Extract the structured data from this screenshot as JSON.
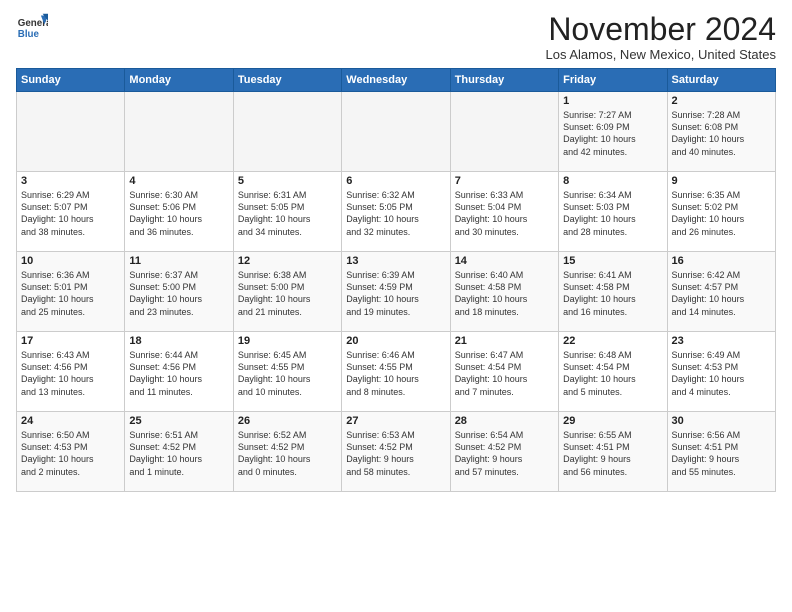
{
  "header": {
    "logo_general": "General",
    "logo_blue": "Blue",
    "month_title": "November 2024",
    "location": "Los Alamos, New Mexico, United States"
  },
  "weekdays": [
    "Sunday",
    "Monday",
    "Tuesday",
    "Wednesday",
    "Thursday",
    "Friday",
    "Saturday"
  ],
  "weeks": [
    [
      {
        "day": "",
        "content": ""
      },
      {
        "day": "",
        "content": ""
      },
      {
        "day": "",
        "content": ""
      },
      {
        "day": "",
        "content": ""
      },
      {
        "day": "",
        "content": ""
      },
      {
        "day": "1",
        "content": "Sunrise: 7:27 AM\nSunset: 6:09 PM\nDaylight: 10 hours\nand 42 minutes."
      },
      {
        "day": "2",
        "content": "Sunrise: 7:28 AM\nSunset: 6:08 PM\nDaylight: 10 hours\nand 40 minutes."
      }
    ],
    [
      {
        "day": "3",
        "content": "Sunrise: 6:29 AM\nSunset: 5:07 PM\nDaylight: 10 hours\nand 38 minutes."
      },
      {
        "day": "4",
        "content": "Sunrise: 6:30 AM\nSunset: 5:06 PM\nDaylight: 10 hours\nand 36 minutes."
      },
      {
        "day": "5",
        "content": "Sunrise: 6:31 AM\nSunset: 5:05 PM\nDaylight: 10 hours\nand 34 minutes."
      },
      {
        "day": "6",
        "content": "Sunrise: 6:32 AM\nSunset: 5:05 PM\nDaylight: 10 hours\nand 32 minutes."
      },
      {
        "day": "7",
        "content": "Sunrise: 6:33 AM\nSunset: 5:04 PM\nDaylight: 10 hours\nand 30 minutes."
      },
      {
        "day": "8",
        "content": "Sunrise: 6:34 AM\nSunset: 5:03 PM\nDaylight: 10 hours\nand 28 minutes."
      },
      {
        "day": "9",
        "content": "Sunrise: 6:35 AM\nSunset: 5:02 PM\nDaylight: 10 hours\nand 26 minutes."
      }
    ],
    [
      {
        "day": "10",
        "content": "Sunrise: 6:36 AM\nSunset: 5:01 PM\nDaylight: 10 hours\nand 25 minutes."
      },
      {
        "day": "11",
        "content": "Sunrise: 6:37 AM\nSunset: 5:00 PM\nDaylight: 10 hours\nand 23 minutes."
      },
      {
        "day": "12",
        "content": "Sunrise: 6:38 AM\nSunset: 5:00 PM\nDaylight: 10 hours\nand 21 minutes."
      },
      {
        "day": "13",
        "content": "Sunrise: 6:39 AM\nSunset: 4:59 PM\nDaylight: 10 hours\nand 19 minutes."
      },
      {
        "day": "14",
        "content": "Sunrise: 6:40 AM\nSunset: 4:58 PM\nDaylight: 10 hours\nand 18 minutes."
      },
      {
        "day": "15",
        "content": "Sunrise: 6:41 AM\nSunset: 4:58 PM\nDaylight: 10 hours\nand 16 minutes."
      },
      {
        "day": "16",
        "content": "Sunrise: 6:42 AM\nSunset: 4:57 PM\nDaylight: 10 hours\nand 14 minutes."
      }
    ],
    [
      {
        "day": "17",
        "content": "Sunrise: 6:43 AM\nSunset: 4:56 PM\nDaylight: 10 hours\nand 13 minutes."
      },
      {
        "day": "18",
        "content": "Sunrise: 6:44 AM\nSunset: 4:56 PM\nDaylight: 10 hours\nand 11 minutes."
      },
      {
        "day": "19",
        "content": "Sunrise: 6:45 AM\nSunset: 4:55 PM\nDaylight: 10 hours\nand 10 minutes."
      },
      {
        "day": "20",
        "content": "Sunrise: 6:46 AM\nSunset: 4:55 PM\nDaylight: 10 hours\nand 8 minutes."
      },
      {
        "day": "21",
        "content": "Sunrise: 6:47 AM\nSunset: 4:54 PM\nDaylight: 10 hours\nand 7 minutes."
      },
      {
        "day": "22",
        "content": "Sunrise: 6:48 AM\nSunset: 4:54 PM\nDaylight: 10 hours\nand 5 minutes."
      },
      {
        "day": "23",
        "content": "Sunrise: 6:49 AM\nSunset: 4:53 PM\nDaylight: 10 hours\nand 4 minutes."
      }
    ],
    [
      {
        "day": "24",
        "content": "Sunrise: 6:50 AM\nSunset: 4:53 PM\nDaylight: 10 hours\nand 2 minutes."
      },
      {
        "day": "25",
        "content": "Sunrise: 6:51 AM\nSunset: 4:52 PM\nDaylight: 10 hours\nand 1 minute."
      },
      {
        "day": "26",
        "content": "Sunrise: 6:52 AM\nSunset: 4:52 PM\nDaylight: 10 hours\nand 0 minutes."
      },
      {
        "day": "27",
        "content": "Sunrise: 6:53 AM\nSunset: 4:52 PM\nDaylight: 9 hours\nand 58 minutes."
      },
      {
        "day": "28",
        "content": "Sunrise: 6:54 AM\nSunset: 4:52 PM\nDaylight: 9 hours\nand 57 minutes."
      },
      {
        "day": "29",
        "content": "Sunrise: 6:55 AM\nSunset: 4:51 PM\nDaylight: 9 hours\nand 56 minutes."
      },
      {
        "day": "30",
        "content": "Sunrise: 6:56 AM\nSunset: 4:51 PM\nDaylight: 9 hours\nand 55 minutes."
      }
    ]
  ]
}
